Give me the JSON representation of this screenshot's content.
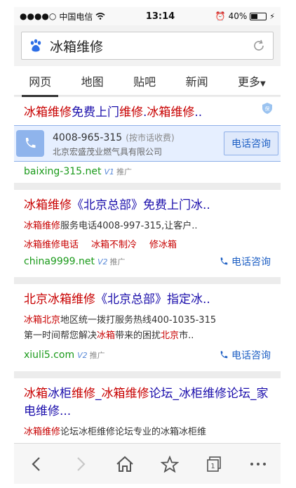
{
  "status_bar": {
    "carrier": "中国电信",
    "time": "13:14",
    "battery": "40%"
  },
  "search": {
    "query": "冰箱维修"
  },
  "tabs": [
    {
      "label": "网页",
      "active": true
    },
    {
      "label": "地图"
    },
    {
      "label": "贴吧"
    },
    {
      "label": "新闻"
    },
    {
      "label": "更多"
    }
  ],
  "results": [
    {
      "title_red": "冰箱维修",
      "title_rest": "免费上门",
      "title_red2": "维修",
      "title_rest2": ".",
      "title_red3": "冰箱维修",
      "title_rest3": "..",
      "call": {
        "number": "4008-965-315",
        "note": "(按市话收费)",
        "company": "北京宏盛茂业燃气具有限公司",
        "button": "电话咨询"
      },
      "url": "baixing-315.net",
      "verified": "V1",
      "ad": "推广"
    },
    {
      "title_red": "冰箱维修",
      "title_rest": "《北京总部》免费上门冰..",
      "desc_red": "冰箱维修",
      "desc_rest": "服务电话4008-997-315,让客户..",
      "links": [
        "冰箱维修电话",
        "冰箱不制冷",
        "修冰箱"
      ],
      "url": "china9999.net",
      "verified": "V2",
      "ad": "推广",
      "phone_label": "电话咨询"
    },
    {
      "title_rest": "北京",
      "title_red": "冰箱维修",
      "title_rest2": "《北京总部》指定冰..",
      "desc_red1": "冰箱",
      "desc_red2": "北京",
      "desc_part1": "地区统一拨打服务热线400-1035-315",
      "desc_part2": "第一时间帮您解决",
      "desc_red3": "冰箱",
      "desc_part3": "带来的困扰",
      "desc_red4": "北京",
      "desc_part4": "市..",
      "url": "xiuli5.com",
      "verified": "V2",
      "ad": "推广",
      "phone_label": "电话咨询"
    },
    {
      "title_red": "冰箱",
      "title_rest": "冰柜",
      "title_red2": "维修",
      "title_rest2": "_",
      "title_red3": "冰箱维修",
      "title_rest3": "论坛_冰柜维修论坛_家电维修...",
      "desc_red": "冰箱维修",
      "desc_rest": "论坛冰柜维修论坛专业的冰箱冰柜维"
    }
  ]
}
